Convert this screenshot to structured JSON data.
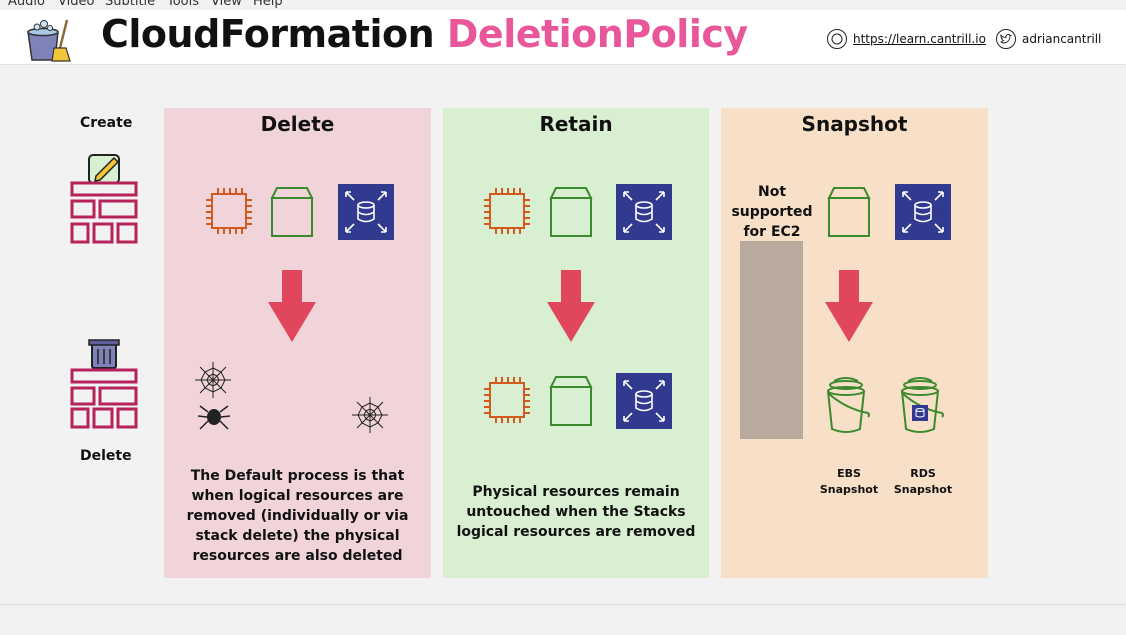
{
  "menu": [
    "Audio",
    "Video",
    "Subtitle",
    "Tools",
    "View",
    "Help"
  ],
  "header": {
    "title_main": "CloudFormation",
    "title_accent": "DeletionPolicy",
    "website": "https://learn.cantrill.io",
    "twitter": "adriancantrill"
  },
  "lifecycle": {
    "create_label": "Create",
    "delete_label": "Delete"
  },
  "panels": {
    "delete": {
      "title": "Delete",
      "description_lines": [
        "The Default process is that",
        "when logical resources are",
        "removed (individually or via",
        "stack delete) the physical",
        "resources are also deleted"
      ]
    },
    "retain": {
      "title": "Retain",
      "description_lines": [
        "Physical resources remain",
        "untouched when the Stacks",
        "logical resources are removed"
      ]
    },
    "snapshot": {
      "title": "Snapshot",
      "note_lines": [
        "Not",
        "supported",
        "for EC2"
      ],
      "ebs_label": [
        "EBS",
        "Snapshot"
      ],
      "rds_label": [
        "RDS",
        "Snapshot"
      ]
    }
  },
  "colors": {
    "delete_bg": "#f1d4d9",
    "retain_bg": "#d8efd1",
    "snapshot_bg": "#f8dfc7",
    "accent_pink": "#e8579a",
    "arrow_red": "#e0465c",
    "ec2_orange": "#d35a1e",
    "ebs_green": "#3b8a2e",
    "rds_navy": "#323a8f",
    "stack_crimson": "#b5235a",
    "not_supported_grey": "#b9aa9e"
  },
  "icons": [
    "ec2-instance-icon",
    "ebs-volume-icon",
    "rds-database-icon",
    "arrow-down-icon",
    "cobweb-icon",
    "spider-icon",
    "bucket-icon",
    "stack-icon",
    "trash-icon",
    "edit-icon",
    "website-icon",
    "twitter-icon"
  ]
}
